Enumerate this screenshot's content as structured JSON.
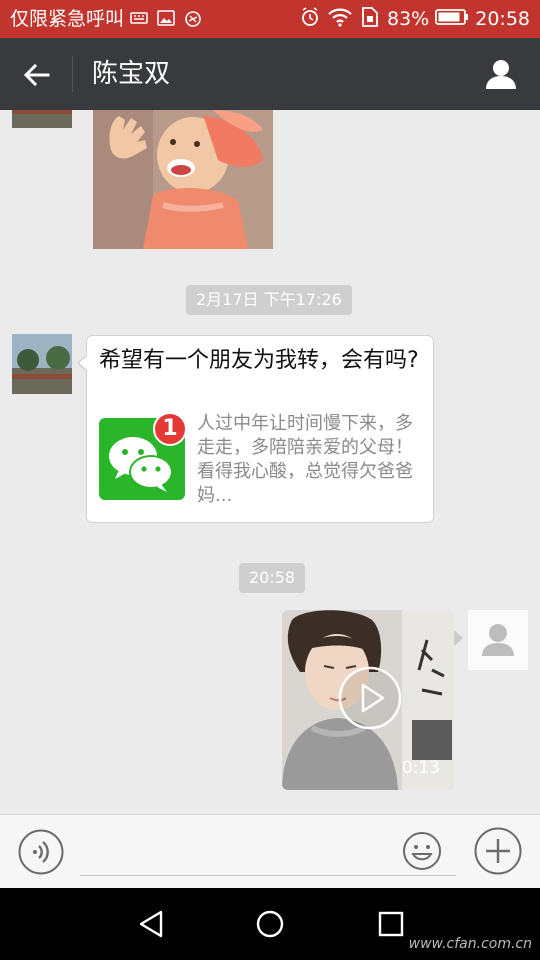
{
  "status_bar": {
    "carrier": "仅限紧急呼叫",
    "battery_percent": "83%",
    "time": "20:58"
  },
  "nav": {
    "title": "陈宝双"
  },
  "chat": {
    "timestamp_1": "2月17日 下午17:26",
    "card": {
      "title": "希望有一个朋友为我转，会有吗?",
      "thumbnail_badge": "1",
      "description": "人过中年让时间慢下来，多走走，多陪陪亲爱的父母！ 看得我心酸，总觉得欠爸爸妈..."
    },
    "timestamp_2": "20:58",
    "video": {
      "duration": "0:13"
    }
  },
  "input_bar": {
    "text_value": ""
  },
  "watermark": "www.cfan.com.cn",
  "colors": {
    "status_bar": "#c1352e",
    "nav_bar": "#393a3e",
    "chat_background": "#ebebeb",
    "wechat_green": "#2bb52b",
    "badge_red": "#e53935"
  }
}
